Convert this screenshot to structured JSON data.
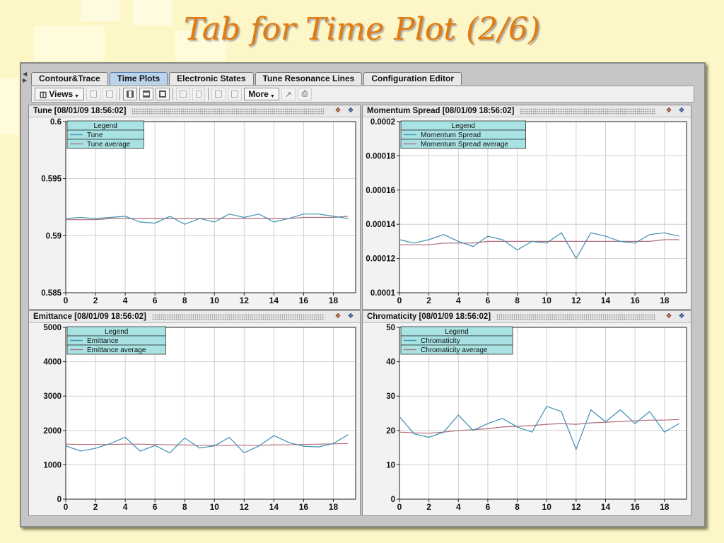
{
  "slide": {
    "title": "Tab for Time Plot (2/6)"
  },
  "tabs": [
    "Contour&Trace",
    "Time Plots",
    "Electronic States",
    "Tune Resonance Lines",
    "Configuration Editor"
  ],
  "active_tab": 1,
  "toolbar": {
    "views_label": "Views",
    "more_label": "More"
  },
  "icons": [
    "chart-export-icon",
    "chart-settings-icon"
  ],
  "colors": {
    "series": "#3c8fb0",
    "average": "#b06a78",
    "legend_bg": "#a8e2e2",
    "slide_bg": "#fdf7c8",
    "title": "#e37b0f"
  },
  "chart_data": [
    {
      "type": "line",
      "title": "Tune  [08/01/09 18:56:02]",
      "legend_title": "Legend",
      "x": [
        0,
        1,
        2,
        3,
        4,
        5,
        6,
        7,
        8,
        9,
        10,
        11,
        12,
        13,
        14,
        15,
        16,
        17,
        18,
        19
      ],
      "xlim": [
        0,
        19.5
      ],
      "xticks": [
        0,
        2,
        4,
        6,
        8,
        10,
        12,
        14,
        16,
        18
      ],
      "ylim": [
        0.585,
        0.6
      ],
      "yticks": [
        0.585,
        0.59,
        0.595,
        0.6
      ],
      "ytick_labels": [
        "0.585",
        "0.59",
        "0.595",
        "0.6"
      ],
      "series": [
        {
          "name": "Tune",
          "values": [
            0.5915,
            0.5916,
            0.5915,
            0.5916,
            0.5917,
            0.5912,
            0.5911,
            0.5917,
            0.591,
            0.5915,
            0.5912,
            0.5919,
            0.5916,
            0.5919,
            0.5912,
            0.5915,
            0.5919,
            0.5919,
            0.5917,
            0.5915
          ]
        },
        {
          "name": "Tune average",
          "values": [
            0.5914,
            0.5914,
            0.5914,
            0.5915,
            0.5915,
            0.5915,
            0.5915,
            0.5915,
            0.5915,
            0.5915,
            0.5915,
            0.5915,
            0.5915,
            0.5915,
            0.5915,
            0.5915,
            0.5916,
            0.5916,
            0.5916,
            0.5917
          ]
        }
      ]
    },
    {
      "type": "line",
      "title": "Momentum Spread  [08/01/09 18:56:02]",
      "legend_title": "Legend",
      "x": [
        0,
        1,
        2,
        3,
        4,
        5,
        6,
        7,
        8,
        9,
        10,
        11,
        12,
        13,
        14,
        15,
        16,
        17,
        18,
        19
      ],
      "xlim": [
        0,
        19.5
      ],
      "xticks": [
        0,
        2,
        4,
        6,
        8,
        10,
        12,
        14,
        16,
        18
      ],
      "ylim": [
        0.0001,
        0.0002
      ],
      "yticks": [
        0.0001,
        0.00012,
        0.00014,
        0.00016,
        0.00018,
        0.0002
      ],
      "ytick_labels": [
        "0.0001",
        "0.00012",
        "0.00014",
        "0.00016",
        "0.00018",
        "0.0002"
      ],
      "series": [
        {
          "name": "Momentum Spread",
          "values": [
            0.000131,
            0.000129,
            0.000131,
            0.000134,
            0.00013,
            0.000127,
            0.000133,
            0.000131,
            0.000125,
            0.00013,
            0.000129,
            0.000135,
            0.00012,
            0.000135,
            0.000133,
            0.00013,
            0.000129,
            0.000134,
            0.000135,
            0.000133
          ]
        },
        {
          "name": "Momentum Spread average",
          "values": [
            0.000128,
            0.000128,
            0.000128,
            0.000129,
            0.000129,
            0.000129,
            0.00013,
            0.00013,
            0.00013,
            0.00013,
            0.00013,
            0.00013,
            0.00013,
            0.00013,
            0.00013,
            0.00013,
            0.00013,
            0.00013,
            0.000131,
            0.000131
          ]
        }
      ]
    },
    {
      "type": "line",
      "title": "Emittance  [08/01/09 18:56:02]",
      "legend_title": "Legend",
      "x": [
        0,
        1,
        2,
        3,
        4,
        5,
        6,
        7,
        8,
        9,
        10,
        11,
        12,
        13,
        14,
        15,
        16,
        17,
        18,
        19
      ],
      "xlim": [
        0,
        19.5
      ],
      "xticks": [
        0,
        2,
        4,
        6,
        8,
        10,
        12,
        14,
        16,
        18
      ],
      "ylim": [
        0,
        5000
      ],
      "yticks": [
        0,
        1000,
        2000,
        3000,
        4000,
        5000
      ],
      "ytick_labels": [
        "0",
        "1000",
        "2000",
        "3000",
        "4000",
        "5000"
      ],
      "series": [
        {
          "name": "Emittance",
          "values": [
            1550,
            1400,
            1480,
            1620,
            1800,
            1400,
            1560,
            1350,
            1780,
            1490,
            1550,
            1800,
            1350,
            1550,
            1850,
            1650,
            1540,
            1520,
            1620,
            1880
          ]
        },
        {
          "name": "Emittance average",
          "values": [
            1600,
            1590,
            1590,
            1590,
            1600,
            1600,
            1590,
            1580,
            1580,
            1570,
            1570,
            1570,
            1570,
            1570,
            1580,
            1580,
            1590,
            1600,
            1610,
            1620
          ]
        }
      ]
    },
    {
      "type": "line",
      "title": "Chromaticity  [08/01/09 18:56:02]",
      "legend_title": "Legend",
      "x": [
        0,
        1,
        2,
        3,
        4,
        5,
        6,
        7,
        8,
        9,
        10,
        11,
        12,
        13,
        14,
        15,
        16,
        17,
        18,
        19
      ],
      "xlim": [
        0,
        19.5
      ],
      "xticks": [
        0,
        2,
        4,
        6,
        8,
        10,
        12,
        14,
        16,
        18
      ],
      "ylim": [
        0,
        50
      ],
      "yticks": [
        0,
        10,
        20,
        30,
        40,
        50
      ],
      "ytick_labels": [
        "0",
        "10",
        "20",
        "30",
        "40",
        "50"
      ],
      "series": [
        {
          "name": "Chromaticity",
          "values": [
            24,
            19,
            18,
            19.5,
            24.5,
            20,
            22,
            23.5,
            21,
            19.5,
            27,
            25.5,
            14.5,
            26,
            22.5,
            26,
            22,
            25.5,
            19.5,
            22
          ]
        },
        {
          "name": "Chromaticity average",
          "values": [
            19.5,
            19.3,
            19.2,
            19.5,
            20,
            20.2,
            20.5,
            21,
            21.2,
            21.4,
            21.8,
            22,
            21.8,
            22.2,
            22.4,
            22.6,
            22.8,
            23,
            23,
            23.2
          ]
        }
      ]
    }
  ]
}
